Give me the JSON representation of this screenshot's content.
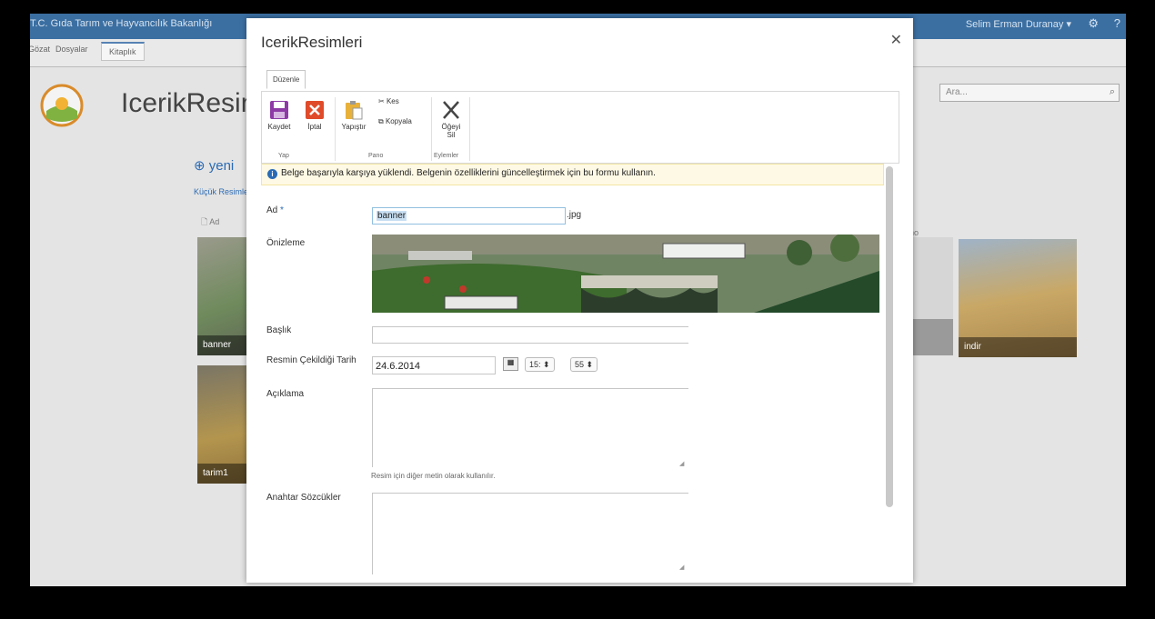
{
  "background": {
    "site_title": "T.C. Gıda Tarım ve Hayvancılık Bakanlığı",
    "user": "Selim Erman Duranay ▾",
    "tabs": [
      "Gözat",
      "Dosyalar",
      "Kitaplık"
    ],
    "page_title": "IcerikResimleri",
    "new_link": "yeni",
    "view_link": "Küçük Resimler",
    "col_header": "Ad",
    "search_placeholder": "Ara...",
    "partial_label": "no",
    "thumbnails": [
      {
        "label": "banner"
      },
      {
        "label": "tarim1"
      },
      {
        "label": "indir"
      }
    ]
  },
  "dialog": {
    "title": "IcerikResimleri",
    "ribbon": {
      "tab": "Düzenle",
      "save": "Kaydet",
      "cancel": "İptal",
      "paste": "Yapıştır",
      "cut": "Kes",
      "copy": "Kopyala",
      "delete_line1": "Öğeyi",
      "delete_line2": "Sil",
      "group_commit": "Yap",
      "group_clipboard": "Pano",
      "group_actions": "Eylemler"
    },
    "info_message": "Belge başarıyla karşıya yüklendi. Belgenin özelliklerini güncelleştirmek için bu formu kullanın.",
    "fields": {
      "name_label": "Ad",
      "name_required": "*",
      "name_value": "banner",
      "name_ext": ".jpg",
      "preview_label": "Önizleme",
      "title_label": "Başlık",
      "title_value": "",
      "date_label": "Resmin Çekildiği Tarih",
      "date_value": "24.6.2014",
      "hour_value": "15:",
      "minute_value": "55",
      "desc_label": "Açıklama",
      "desc_value": "",
      "desc_hint": "Resim için diğer metin olarak kullanılır.",
      "keywords_label": "Anahtar Sözcükler",
      "keywords_value": ""
    }
  },
  "colors": {
    "accent": "#2a6bb5",
    "top_bar": "#3b6fa2",
    "info_bg": "#fef9e4"
  }
}
